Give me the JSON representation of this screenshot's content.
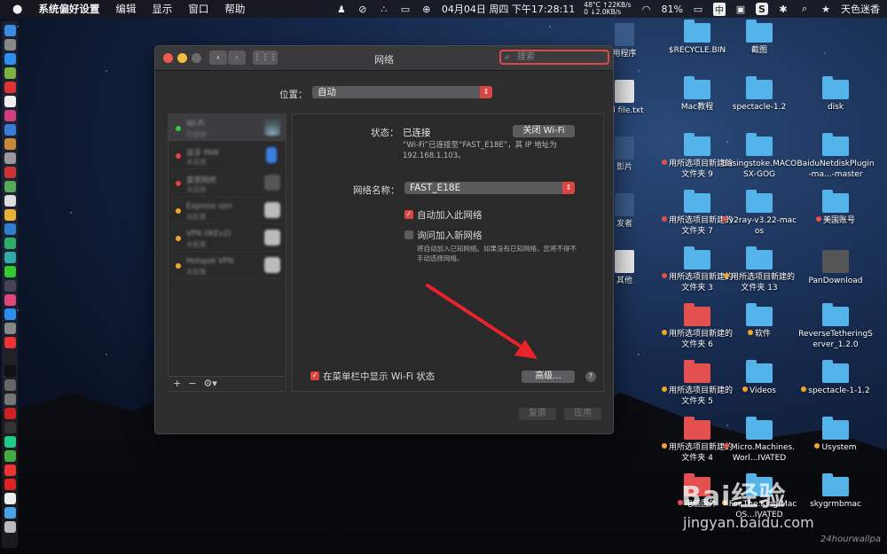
{
  "menubar": {
    "app": "系统偏好设置",
    "items": [
      "编辑",
      "显示",
      "窗口",
      "帮助"
    ],
    "date": "04月04日",
    "weekday": "周四",
    "time": "下午17:28:11",
    "temp": "48°C",
    "up": "0",
    "upspeed": "22KB/s",
    "downspeed": "2.0KB/s",
    "battery": "81%",
    "input": "中",
    "user": "天色迷香"
  },
  "window": {
    "title": "网络",
    "search_placeholder": "搜索",
    "location_label": "位置：",
    "location_value": "自动",
    "status_label": "状态：",
    "status_value": "已连接",
    "wifi_off_button": "关闭 Wi-Fi",
    "status_desc": "“Wi-Fi”已连接至“FAST_E18E”，其 IP 地址为 192.168.1.103。",
    "network_name_label": "网络名称：",
    "network_name_value": "FAST_E18E",
    "auto_join_label": "自动加入此网络",
    "ask_join_label": "询问加入新网络",
    "ask_join_desc": "将自动加入已知网络。如果没有已知网络，您将不得不手动选择网络。",
    "show_wifi_status_label": "在菜单栏中显示 Wi-Fi 状态",
    "advanced_button": "高级...",
    "revert_button": "复原",
    "apply_button": "应用",
    "sidebar_footer": {
      "add": "+",
      "remove": "−",
      "gear": "⚙▾"
    },
    "services": [
      {
        "name": "Wi-Fi",
        "status": "已连接",
        "dot": "#39c748"
      },
      {
        "name": "蓝牙 PAN",
        "status": "未连接",
        "dot": "#e0443e"
      },
      {
        "name": "雷雳网桥",
        "status": "未连接",
        "dot": "#e0443e"
      },
      {
        "name": "Express vpn",
        "status": "未配置",
        "dot": "#f0a82c"
      },
      {
        "name": "VPN (IKEv2)",
        "status": "未配置",
        "dot": "#f0a82c"
      },
      {
        "name": "Hotspot VPN",
        "status": "未配置",
        "dot": "#f0a82c"
      }
    ]
  },
  "desktop": {
    "icons": [
      {
        "label": "用程序",
        "color": ""
      },
      {
        "label": "$RECYCLE.BIN",
        "color": ""
      },
      {
        "label": "截图",
        "color": ""
      },
      {
        "label": "ed file.txt",
        "color": ""
      },
      {
        "label": "Mac教程",
        "color": ""
      },
      {
        "label": "spectacle-1.2",
        "color": ""
      },
      {
        "label": "disk",
        "color": ""
      },
      {
        "label": "影片",
        "color": ""
      },
      {
        "label": "用所选项目新建的文件夹 9",
        "color": "#e44f4f"
      },
      {
        "label": "Basingstoke.MACOSX-GOG",
        "color": ""
      },
      {
        "label": "BaiduNetdiskPlugin-ma...-master",
        "color": ""
      },
      {
        "label": "发者",
        "color": ""
      },
      {
        "label": "用所选项目新建的文件夹 7",
        "color": "#e44f4f"
      },
      {
        "label": "v2ray-v3.22-macos",
        "color": "#e44f4f"
      },
      {
        "label": "美国账号",
        "color": "#e44f4f"
      },
      {
        "label": "其他",
        "color": ""
      },
      {
        "label": "用所选项目新建的文件夹 3",
        "color": "#e44f4f"
      },
      {
        "label": "用所选项目新建的文件夹 13",
        "color": "#f0a82c"
      },
      {
        "label": "PanDownload",
        "color": ""
      },
      {
        "label": "用所选项目新建的文件夹 6",
        "color": "#f0a82c"
      },
      {
        "label": "软件",
        "color": "#f0a82c"
      },
      {
        "label": "ReverseTetheringServer_1.2.0",
        "color": ""
      },
      {
        "label": "用所选项目新建的文件夹 5",
        "color": "#f0a82c"
      },
      {
        "label": "Videos",
        "color": "#f0a82c"
      },
      {
        "label": "spectacle-1-1.2",
        "color": "#f0a82c"
      },
      {
        "label": "用所选项目新建的文件夹 4",
        "color": "#f0a82c"
      },
      {
        "label": "Micro.Machines.Worl...IVATED",
        "color": "#e44f4f"
      },
      {
        "label": "Usystem",
        "color": "#f0a82c"
      },
      {
        "label": "电脑国外",
        "color": "#e44f4f"
      },
      {
        "label": "For.The.King.MacOS...IVATED",
        "color": "#f0a82c"
      },
      {
        "label": "skygrmbmac",
        "color": ""
      }
    ]
  },
  "watermark": {
    "brand": "Bai经验",
    "url": "jingyan.baidu.com",
    "credit": "24hourwallpa"
  }
}
